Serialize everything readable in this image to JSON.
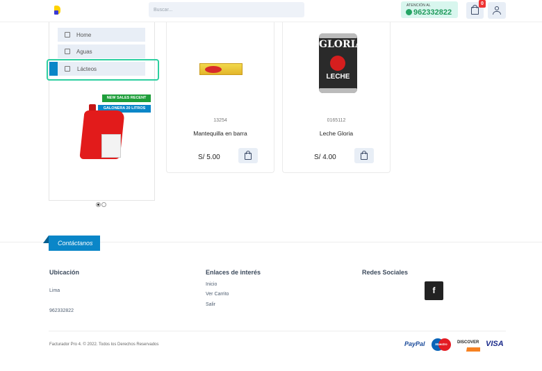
{
  "header": {
    "search_placeholder": "Buscar...",
    "attention_label": "ATENCIÓN AL",
    "phone": "962332822",
    "cart_count": "0"
  },
  "sidebar": {
    "items": [
      {
        "label": "Home",
        "icon": "home-icon"
      },
      {
        "label": "Aguas",
        "icon": "box-icon"
      },
      {
        "label": "Lácteos",
        "icon": "box-icon"
      }
    ],
    "banner": {
      "tag1": "NEW SALES RECENT",
      "tag2": "GALONERA 20 LITROS"
    }
  },
  "products": [
    {
      "sku": "13254",
      "name": "Mantequilla en barra",
      "price": "S/ 5.00"
    },
    {
      "sku": "0165112",
      "name": "Leche Gloria",
      "price": "S/ 4.00",
      "can_brand": "GLORIA",
      "can_label": "LECHE"
    }
  ],
  "footer": {
    "contact_tab": "Contáctanos",
    "ubicacion": {
      "title": "Ubicación",
      "city": "Lima",
      "phone": "962332822"
    },
    "enlaces": {
      "title": "Enlaces de interés",
      "links": [
        "Inicio",
        "Ver Carrito",
        "Salir"
      ]
    },
    "redes": {
      "title": "Redes Sociales",
      "facebook": "f"
    },
    "copyright": "Facturador Pro 4. © 2022. Todos los Derechos Reservados",
    "payments": {
      "paypal": "PayPal",
      "maestro": "Maestro",
      "discover": "DISCOVER",
      "visa": "VISA"
    }
  },
  "colors": {
    "accent": "#0a86c8",
    "whatsapp": "#1f9a5b",
    "focus": "#2dcfa0"
  }
}
